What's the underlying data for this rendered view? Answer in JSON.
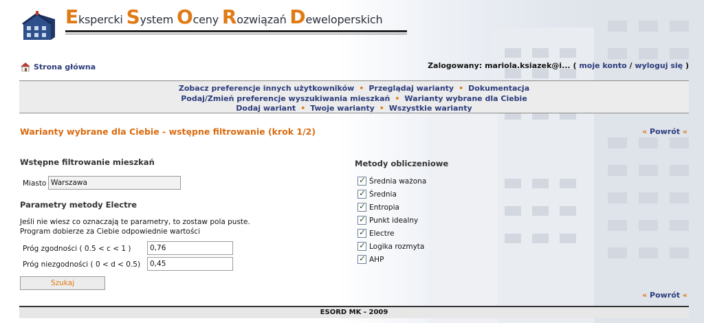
{
  "header": {
    "logo_words": [
      {
        "initial": "E",
        "rest": "kspercki "
      },
      {
        "initial": "S",
        "rest": "ystem "
      },
      {
        "initial": "O",
        "rest": "ceny "
      },
      {
        "initial": "R",
        "rest": "ozwiązań "
      },
      {
        "initial": "D",
        "rest": "eweloperskich"
      }
    ],
    "home_label": "Strona główna",
    "login": {
      "prefix": "Zalogowany:",
      "user": "mariola.ksiazek@i...",
      "open_paren": "(",
      "account_link": "moje konto",
      "separator": "/",
      "logout_link": "wyloguj się",
      "close_paren": ")"
    }
  },
  "nav": {
    "bullet": "•",
    "rows": [
      [
        "Zobacz preferencje innych użytkowników",
        "Przeglądaj warianty",
        "Dokumentacja"
      ],
      [
        "Podaj/Zmień preferencje wyszukiwania mieszkań",
        "Warianty wybrane dla Ciebie"
      ],
      [
        "Dodaj wariant",
        "Twoje warianty",
        "Wszystkie warianty"
      ]
    ]
  },
  "main": {
    "page_title": "Warianty wybrane dla Ciebie - wstępne filtrowanie (krok 1/2)",
    "back": {
      "left": "«",
      "label": "Powrót",
      "right": "«"
    },
    "filter": {
      "heading": "Wstępne filtrowanie mieszkań",
      "city_label": "Miasto",
      "city_value": "Warszawa"
    },
    "electre": {
      "heading": "Parametry metody Electre",
      "hint_line1": "Jeśli nie wiesz co oznaczają te parametry, to zostaw pola puste.",
      "hint_line2": "Program dobierze za Ciebie odpowiednie wartości",
      "concordance_label": "Próg zgodności ( 0.5 < c < 1 )",
      "concordance_value": "0,76",
      "discordance_label": "Próg niezgodności ( 0 < d < 0.5)",
      "discordance_value": "0,45"
    },
    "search_button": "Szukaj",
    "methods": {
      "heading": "Metody obliczeniowe",
      "items": [
        {
          "label": "Średnia ważona",
          "checked": true
        },
        {
          "label": "Średnia",
          "checked": true
        },
        {
          "label": "Entropia",
          "checked": true
        },
        {
          "label": "Punkt idealny",
          "checked": true
        },
        {
          "label": "Electre",
          "checked": true
        },
        {
          "label": "Logika rozmyta",
          "checked": true
        },
        {
          "label": "AHP",
          "checked": true
        }
      ]
    }
  },
  "footer": {
    "text": "ESORD MK - 2009"
  },
  "colors": {
    "accent": "#e07a14",
    "link": "#2b3b7a",
    "title": "#d96a0f"
  },
  "icons": {
    "home": "house-with-red-roof-icon",
    "logo": "building-logo-icon"
  }
}
